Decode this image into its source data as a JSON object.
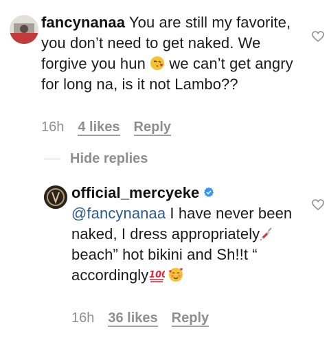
{
  "comments": [
    {
      "username": "fancynanaa",
      "text_part1": "You are still my favorite, you don’t need to get naked. We forgive you hun",
      "text_part2": "we can’t get angry for long na, is it not Lambo??",
      "time": "16h",
      "likes": "4 likes",
      "reply": "Reply",
      "emoji": "kissing-face-with-heart-emoji"
    },
    {
      "username": "official_mercyeke",
      "verified": true,
      "mention": "@fancynanaa",
      "text_part1": "I have never been naked, I dress appropriately",
      "text_part2": "beach” hot bikini and Sh!!t “ accordingly",
      "time": "16h",
      "likes": "36 likes",
      "reply": "Reply",
      "emojis": [
        "syringe-emoji",
        "hundred-points-emoji",
        "smiling-face-with-hearts-emoji"
      ]
    }
  ],
  "hide_replies": "Hide replies",
  "colors": {
    "text": "#1a1a1a",
    "meta": "#8e8e8e",
    "mention": "#2c5a8f",
    "verified": "#3897f0"
  }
}
